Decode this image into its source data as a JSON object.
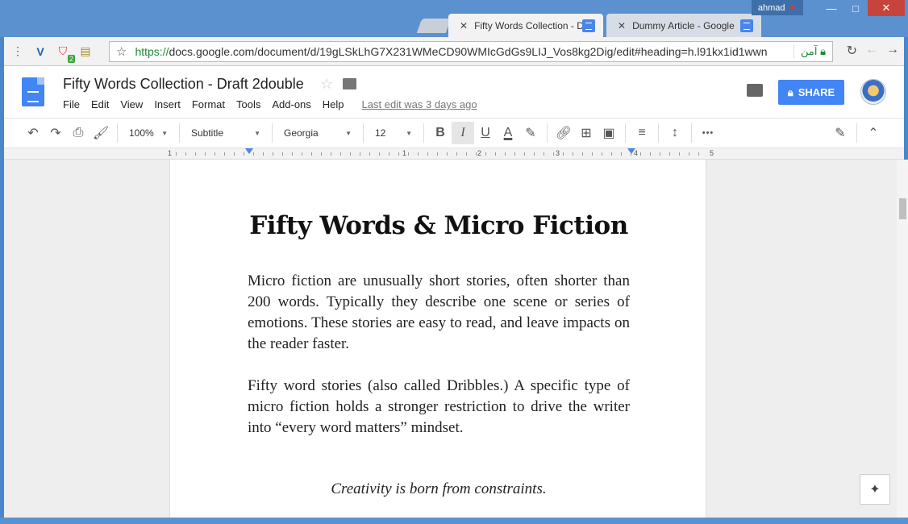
{
  "window": {
    "user": "ahmad",
    "controls": {
      "minimize": "—",
      "maximize": "□",
      "close": "✕"
    }
  },
  "tabs": [
    {
      "title": "Fifty Words Collection - D",
      "close": "✕"
    },
    {
      "title": "Dummy Article - Google",
      "close": "✕"
    }
  ],
  "browser": {
    "menu_icon": "⋮",
    "url_scheme": "https://",
    "url_rest": "docs.google.com/document/d/19gLSkLhG7X231WMeCD90WMIcGdGs9LIJ_Vos8kg2Dig/edit#heading=h.l91kx1id1wwn",
    "secure_label": "آمن",
    "ext_badge": "2"
  },
  "docs": {
    "title": "Fifty Words Collection - Draft 2double",
    "menu": [
      "File",
      "Edit",
      "View",
      "Insert",
      "Format",
      "Tools",
      "Add-ons",
      "Help"
    ],
    "last_edit": "Last edit was 3 days ago",
    "share_label": "SHARE"
  },
  "toolbar": {
    "zoom": "100%",
    "style": "Subtitle",
    "font": "Georgia",
    "size": "12",
    "bold": "B",
    "italic": "I",
    "underline": "U",
    "textcolor": "A",
    "more": "•••"
  },
  "ruler": {
    "labels": [
      "1",
      "1",
      "2",
      "3",
      "4",
      "5"
    ]
  },
  "document": {
    "heading": "Fifty Words & Micro Fiction",
    "para1": "Micro fiction are unusually short stories, often shorter than 200 words. Typically they describe one scene or series of emotions. These stories are easy to read, and leave impacts on the reader faster.",
    "para2": "Fifty word stories (also called Dribbles.) A specific type of micro fiction holds a stronger restriction to drive the writer into “every word matters” mindset.",
    "quote": "Creativity is born from constraints."
  },
  "colors": {
    "accent": "#4285f4",
    "titlebar": "#5b91cf",
    "secure": "#1a8a34"
  }
}
